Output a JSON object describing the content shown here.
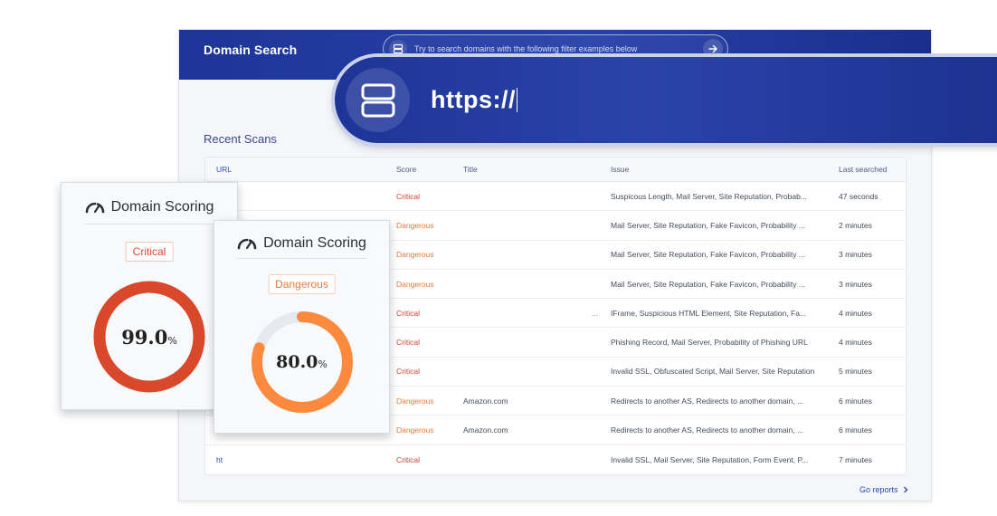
{
  "app": {
    "title": "Domain Search",
    "search_placeholder": "Try to search domains with the following filter examples below",
    "zoom_search_value": "https://"
  },
  "recent_scans": {
    "title": "Recent Scans",
    "columns": {
      "url": "URL",
      "score": "Score",
      "title": "Title",
      "issue": "Issue",
      "last": "Last searched"
    },
    "rows": [
      {
        "url": "\\/",
        "score": "Critical",
        "title": "",
        "issue": "Suspicous Length, Mail Server, Site Reputation, Probab...",
        "last": "47 seconds"
      },
      {
        "url": "",
        "score": "Dangerous",
        "title": "",
        "issue": "Mail Server, Site Reputation, Fake Favicon, Probability ...",
        "last": "2 minutes"
      },
      {
        "url": "",
        "score": "Dangerous",
        "title": "",
        "issue": "Mail Server, Site Reputation, Fake Favicon, Probability ...",
        "last": "3 minutes"
      },
      {
        "url": "",
        "score": "Dangerous",
        "title": "",
        "issue": "Mail Server, Site Reputation, Fake Favicon, Probability ...",
        "last": "3 minutes"
      },
      {
        "url": "",
        "score": "Critical",
        "title": "",
        "dots": "...",
        "issue": "IFrame, Suspicious HTML Element, Site Reputation, Fa...",
        "last": "4 minutes"
      },
      {
        "url": "",
        "score": "Critical",
        "title": "",
        "issue": "Phishing Record, Mail Server, Probability of Phishing URL",
        "last": "4 minutes"
      },
      {
        "url": "",
        "score": "Critical",
        "title": "",
        "issue": "Invalid SSL, Obfuscated Script, Mail Server, Site Reputation",
        "last": "5 minutes"
      },
      {
        "url": "",
        "score": "Dangerous",
        "title": "Amazon.com",
        "issue": "Redirects to another AS, Redirects to another domain, ...",
        "last": "6 minutes"
      },
      {
        "url": "",
        "score": "Dangerous",
        "title": "Amazon.com",
        "issue": "Redirects to another AS, Redirects to another domain, ...",
        "last": "6 minutes"
      },
      {
        "url": "ht",
        "score": "Critical",
        "title": "",
        "issue": "Invalid SSL, Mail Server, Site Reputation, Form Event, P...",
        "last": "7 minutes"
      }
    ],
    "go_reports": "Go reports"
  },
  "cards": [
    {
      "title": "Domain Scoring",
      "badge": "Critical",
      "value": "99.0",
      "pct": "%",
      "fraction": 0.99,
      "color": "#d9482b",
      "track": "#e8ecf1"
    },
    {
      "title": "Domain Scoring",
      "badge": "Dangerous",
      "value": "80.0",
      "pct": "%",
      "fraction": 0.8,
      "color": "#fb8a3e",
      "track": "#e6e9ee"
    }
  ],
  "colors": {
    "brand": "#21399e",
    "critical": "#d8402a",
    "dangerous": "#e9783a",
    "link": "#2d4aa8"
  },
  "icons": [
    "server-icon",
    "arrow-right-icon",
    "gauge-icon",
    "chevron-right-icon"
  ]
}
